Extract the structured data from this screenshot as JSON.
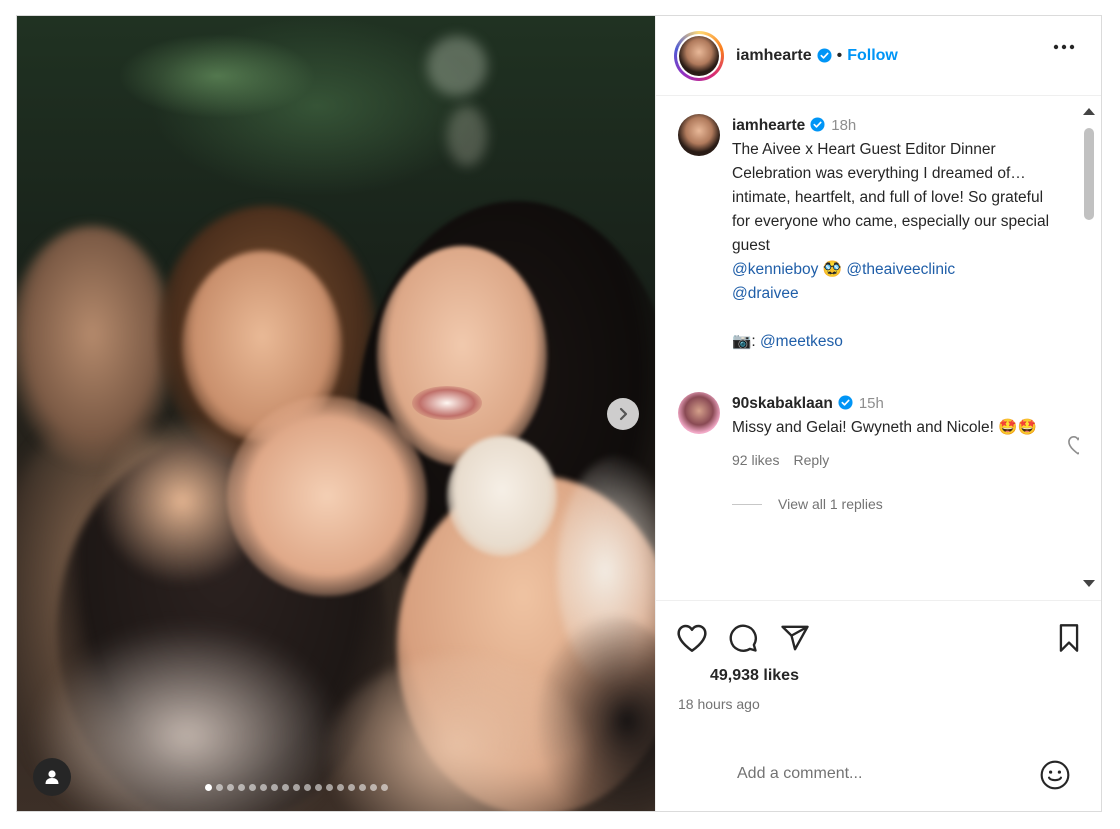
{
  "header": {
    "username": "iamhearte",
    "separator": "•",
    "follow_label": "Follow"
  },
  "caption": {
    "username": "iamhearte",
    "time": "18h",
    "text": "The Aivee x Heart Guest Editor Dinner Celebration was everything I dreamed of…intimate, heartfelt, and full of love! So grateful for everyone who came, especially our special guest",
    "mention_1": "@kennieboy",
    "emoji_1": "🥸",
    "mention_2": "@theaiveeclinic",
    "mention_3": "@draivee",
    "camera_emoji": "📷",
    "credit_sep": ":",
    "mention_4": "@meetkeso"
  },
  "comment": {
    "username": "90skabaklaan",
    "time": "15h",
    "text": "Missy and Gelai! Gwyneth and Nicole! 🤩🤩",
    "likes": "92 likes",
    "reply_label": "Reply",
    "view_replies": "View all 1 replies"
  },
  "post": {
    "likes": "49,938 likes",
    "posted_ago": "18 hours ago",
    "carousel_count": 17,
    "carousel_active_index": 0
  },
  "composer": {
    "placeholder": "Add a comment..."
  },
  "icons": {
    "verified": "verified-badge-icon",
    "more": "more-options-icon",
    "like": "heart-icon",
    "comment": "comment-bubble-icon",
    "share": "paper-plane-icon",
    "save": "bookmark-icon",
    "emoji": "emoji-smiley-icon",
    "next": "chevron-right-icon",
    "user_tag": "user-tag-icon"
  },
  "colors": {
    "accent": "#0095f6",
    "verified": "#0095f6",
    "mention": "#1f5ea8",
    "muted_text": "#737373"
  }
}
